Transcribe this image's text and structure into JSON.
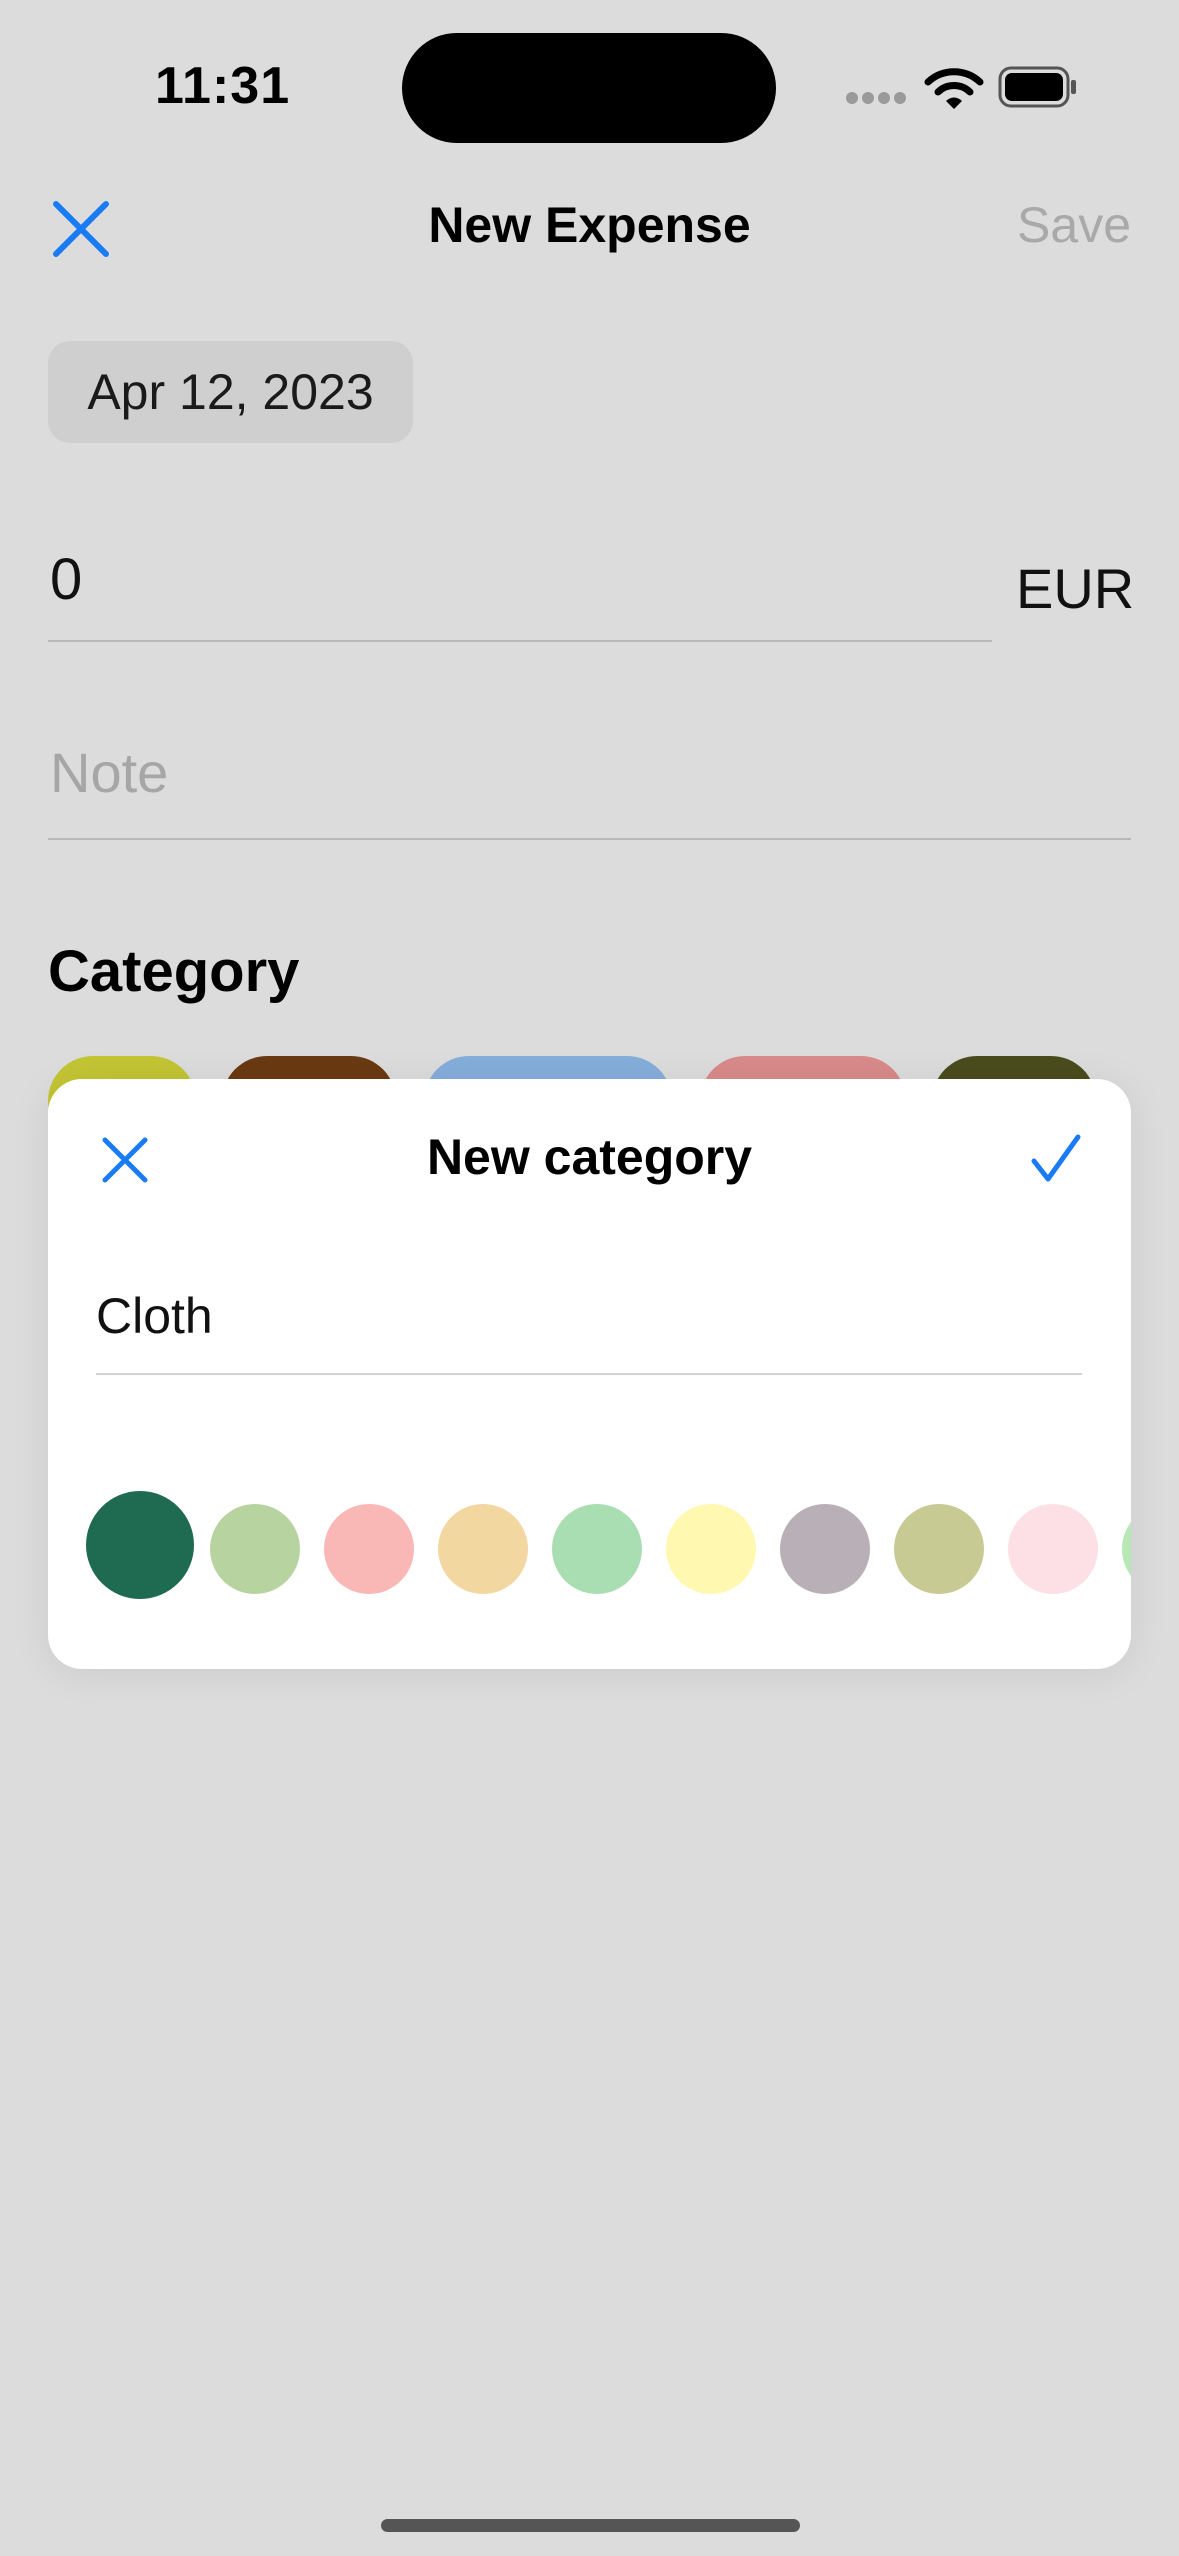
{
  "status_bar": {
    "time": "11:31"
  },
  "nav": {
    "title": "New Expense",
    "save_label": "Save"
  },
  "form": {
    "date": "Apr 12, 2023",
    "amount": "0",
    "currency": "EUR",
    "note_placeholder": "Note",
    "category_heading": "Category"
  },
  "category_chips": [
    {
      "color": "#c3c534"
    },
    {
      "color": "#6a3a12"
    },
    {
      "color": "#86aedb"
    },
    {
      "color": "#d98a8a"
    },
    {
      "color": "#4a4c1d"
    }
  ],
  "modal": {
    "title": "New category",
    "name_value": "Cloth",
    "swatches": [
      {
        "color": "#1e6b52",
        "selected": true
      },
      {
        "color": "#b7d4a0"
      },
      {
        "color": "#f9b8b5"
      },
      {
        "color": "#f2d8a0"
      },
      {
        "color": "#a9ddb2"
      },
      {
        "color": "#fff8b0"
      },
      {
        "color": "#b9afb6"
      },
      {
        "color": "#c8ca93"
      },
      {
        "color": "#fde0e6"
      },
      {
        "color": "#b7e8b5"
      }
    ]
  },
  "colors": {
    "accent": "#1a7cf5",
    "background": "#dcdcdc"
  }
}
